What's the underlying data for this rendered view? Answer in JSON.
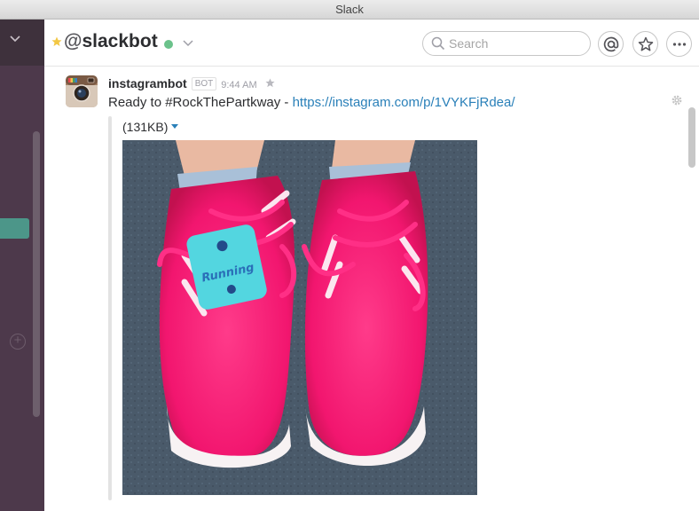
{
  "window": {
    "title": "Slack"
  },
  "header": {
    "at_symbol": "@",
    "channel": "slackbot",
    "search_placeholder": "Search",
    "presence_color": "#6bc28b"
  },
  "message": {
    "author": "instagrambot",
    "badge": "BOT",
    "time": "9:44 AM",
    "text_prefix": "Ready to #RockThePartkway - ",
    "link": "https://instagram.com/p/1VYKFjRdea/",
    "attachment_size": "(131KB)"
  },
  "colors": {
    "sidebar": "#4d394b",
    "sidebar_active": "#4c9689",
    "link": "#2a80b9"
  }
}
